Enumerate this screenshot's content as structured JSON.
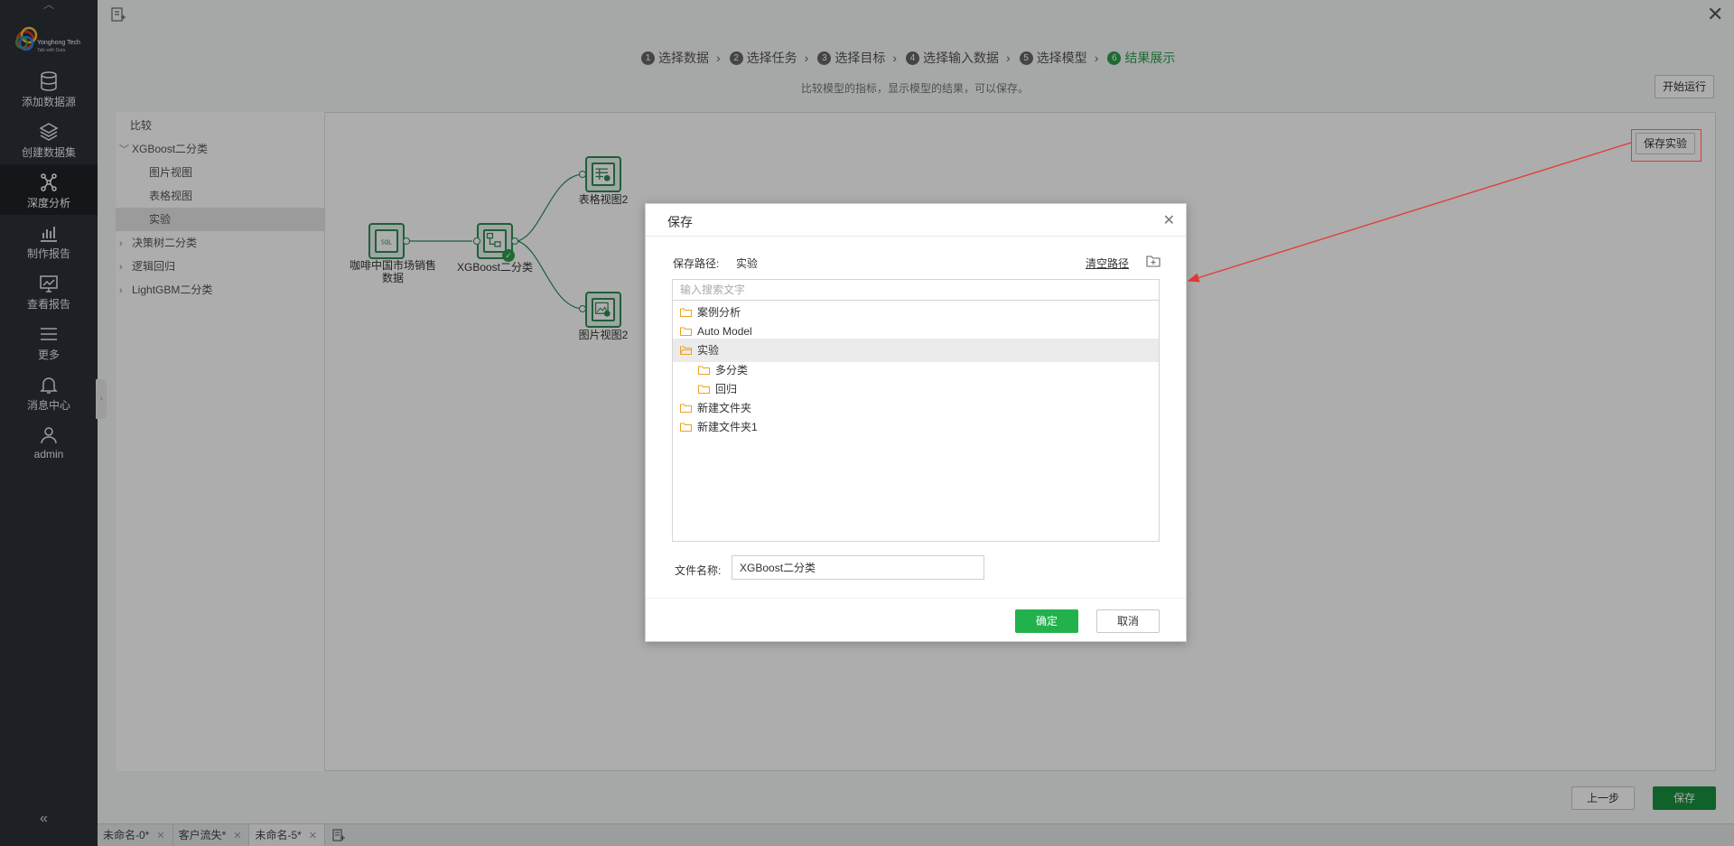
{
  "brand": {
    "name": "Yonghong Tech",
    "tagline": "Talk with Data"
  },
  "sidebar": {
    "items": [
      {
        "label": "添加数据源",
        "icon": "database-icon"
      },
      {
        "label": "创建数据集",
        "icon": "layers-icon"
      },
      {
        "label": "深度分析",
        "icon": "network-icon",
        "active": true
      },
      {
        "label": "制作报告",
        "icon": "chart-icon"
      },
      {
        "label": "查看报告",
        "icon": "monitor-chart-icon"
      },
      {
        "label": "更多",
        "icon": "menu-icon"
      },
      {
        "label": "消息中心",
        "icon": "bell-icon"
      },
      {
        "label": "admin",
        "icon": "user-icon"
      }
    ],
    "collapse": "«"
  },
  "steps": [
    {
      "num": "1",
      "label": "选择数据"
    },
    {
      "num": "2",
      "label": "选择任务"
    },
    {
      "num": "3",
      "label": "选择目标"
    },
    {
      "num": "4",
      "label": "选择输入数据"
    },
    {
      "num": "5",
      "label": "选择模型"
    },
    {
      "num": "6",
      "label": "结果展示",
      "active": true
    }
  ],
  "subtitle": "比较模型的指标，显示模型的结果，可以保存。",
  "buttons": {
    "start": "开始运行",
    "save_experiment": "保存实验",
    "prev": "上一步",
    "save": "保存"
  },
  "tree": {
    "items": [
      {
        "label": "比较"
      },
      {
        "label": "XGBoost二分类",
        "chevron": "﹀"
      },
      {
        "label": "图片视图"
      },
      {
        "label": "表格视图"
      },
      {
        "label": "实验",
        "selected": true
      },
      {
        "label": "决策树二分类",
        "chevron": "›"
      },
      {
        "label": "逻辑回归",
        "chevron": "›"
      },
      {
        "label": "LightGBM二分类",
        "chevron": "›"
      }
    ]
  },
  "flow": {
    "nodes": [
      {
        "label_line1": "咖啡中国市场销售",
        "label_line2": "数据"
      },
      {
        "label": "XGBoost二分类"
      },
      {
        "label": "表格视图2"
      },
      {
        "label": "图片视图2"
      }
    ]
  },
  "dialog": {
    "title": "保存",
    "path_label": "保存路径:",
    "path_value": "实验",
    "clear_path": "清空路径",
    "search_placeholder": "输入搜索文字",
    "folders": [
      {
        "label": "案例分析",
        "level": 0
      },
      {
        "label": "Auto Model",
        "level": 0
      },
      {
        "label": "实验",
        "level": 0,
        "selected": true
      },
      {
        "label": "多分类",
        "level": 1
      },
      {
        "label": "回归",
        "level": 1
      },
      {
        "label": "新建文件夹",
        "level": 0
      },
      {
        "label": "新建文件夹1",
        "level": 0
      }
    ],
    "filename_label": "文件名称:",
    "filename_value": "XGBoost二分类",
    "ok": "确定",
    "cancel": "取消"
  },
  "tabs": [
    {
      "label": "未命名-0*"
    },
    {
      "label": "客户流失*"
    },
    {
      "label": "未命名-5*",
      "active": true
    }
  ],
  "colors": {
    "accent_green": "#22b14c",
    "sidebar_bg": "#2b3036",
    "annotation_red": "#e53935",
    "folder_orange": "#f0a020"
  }
}
